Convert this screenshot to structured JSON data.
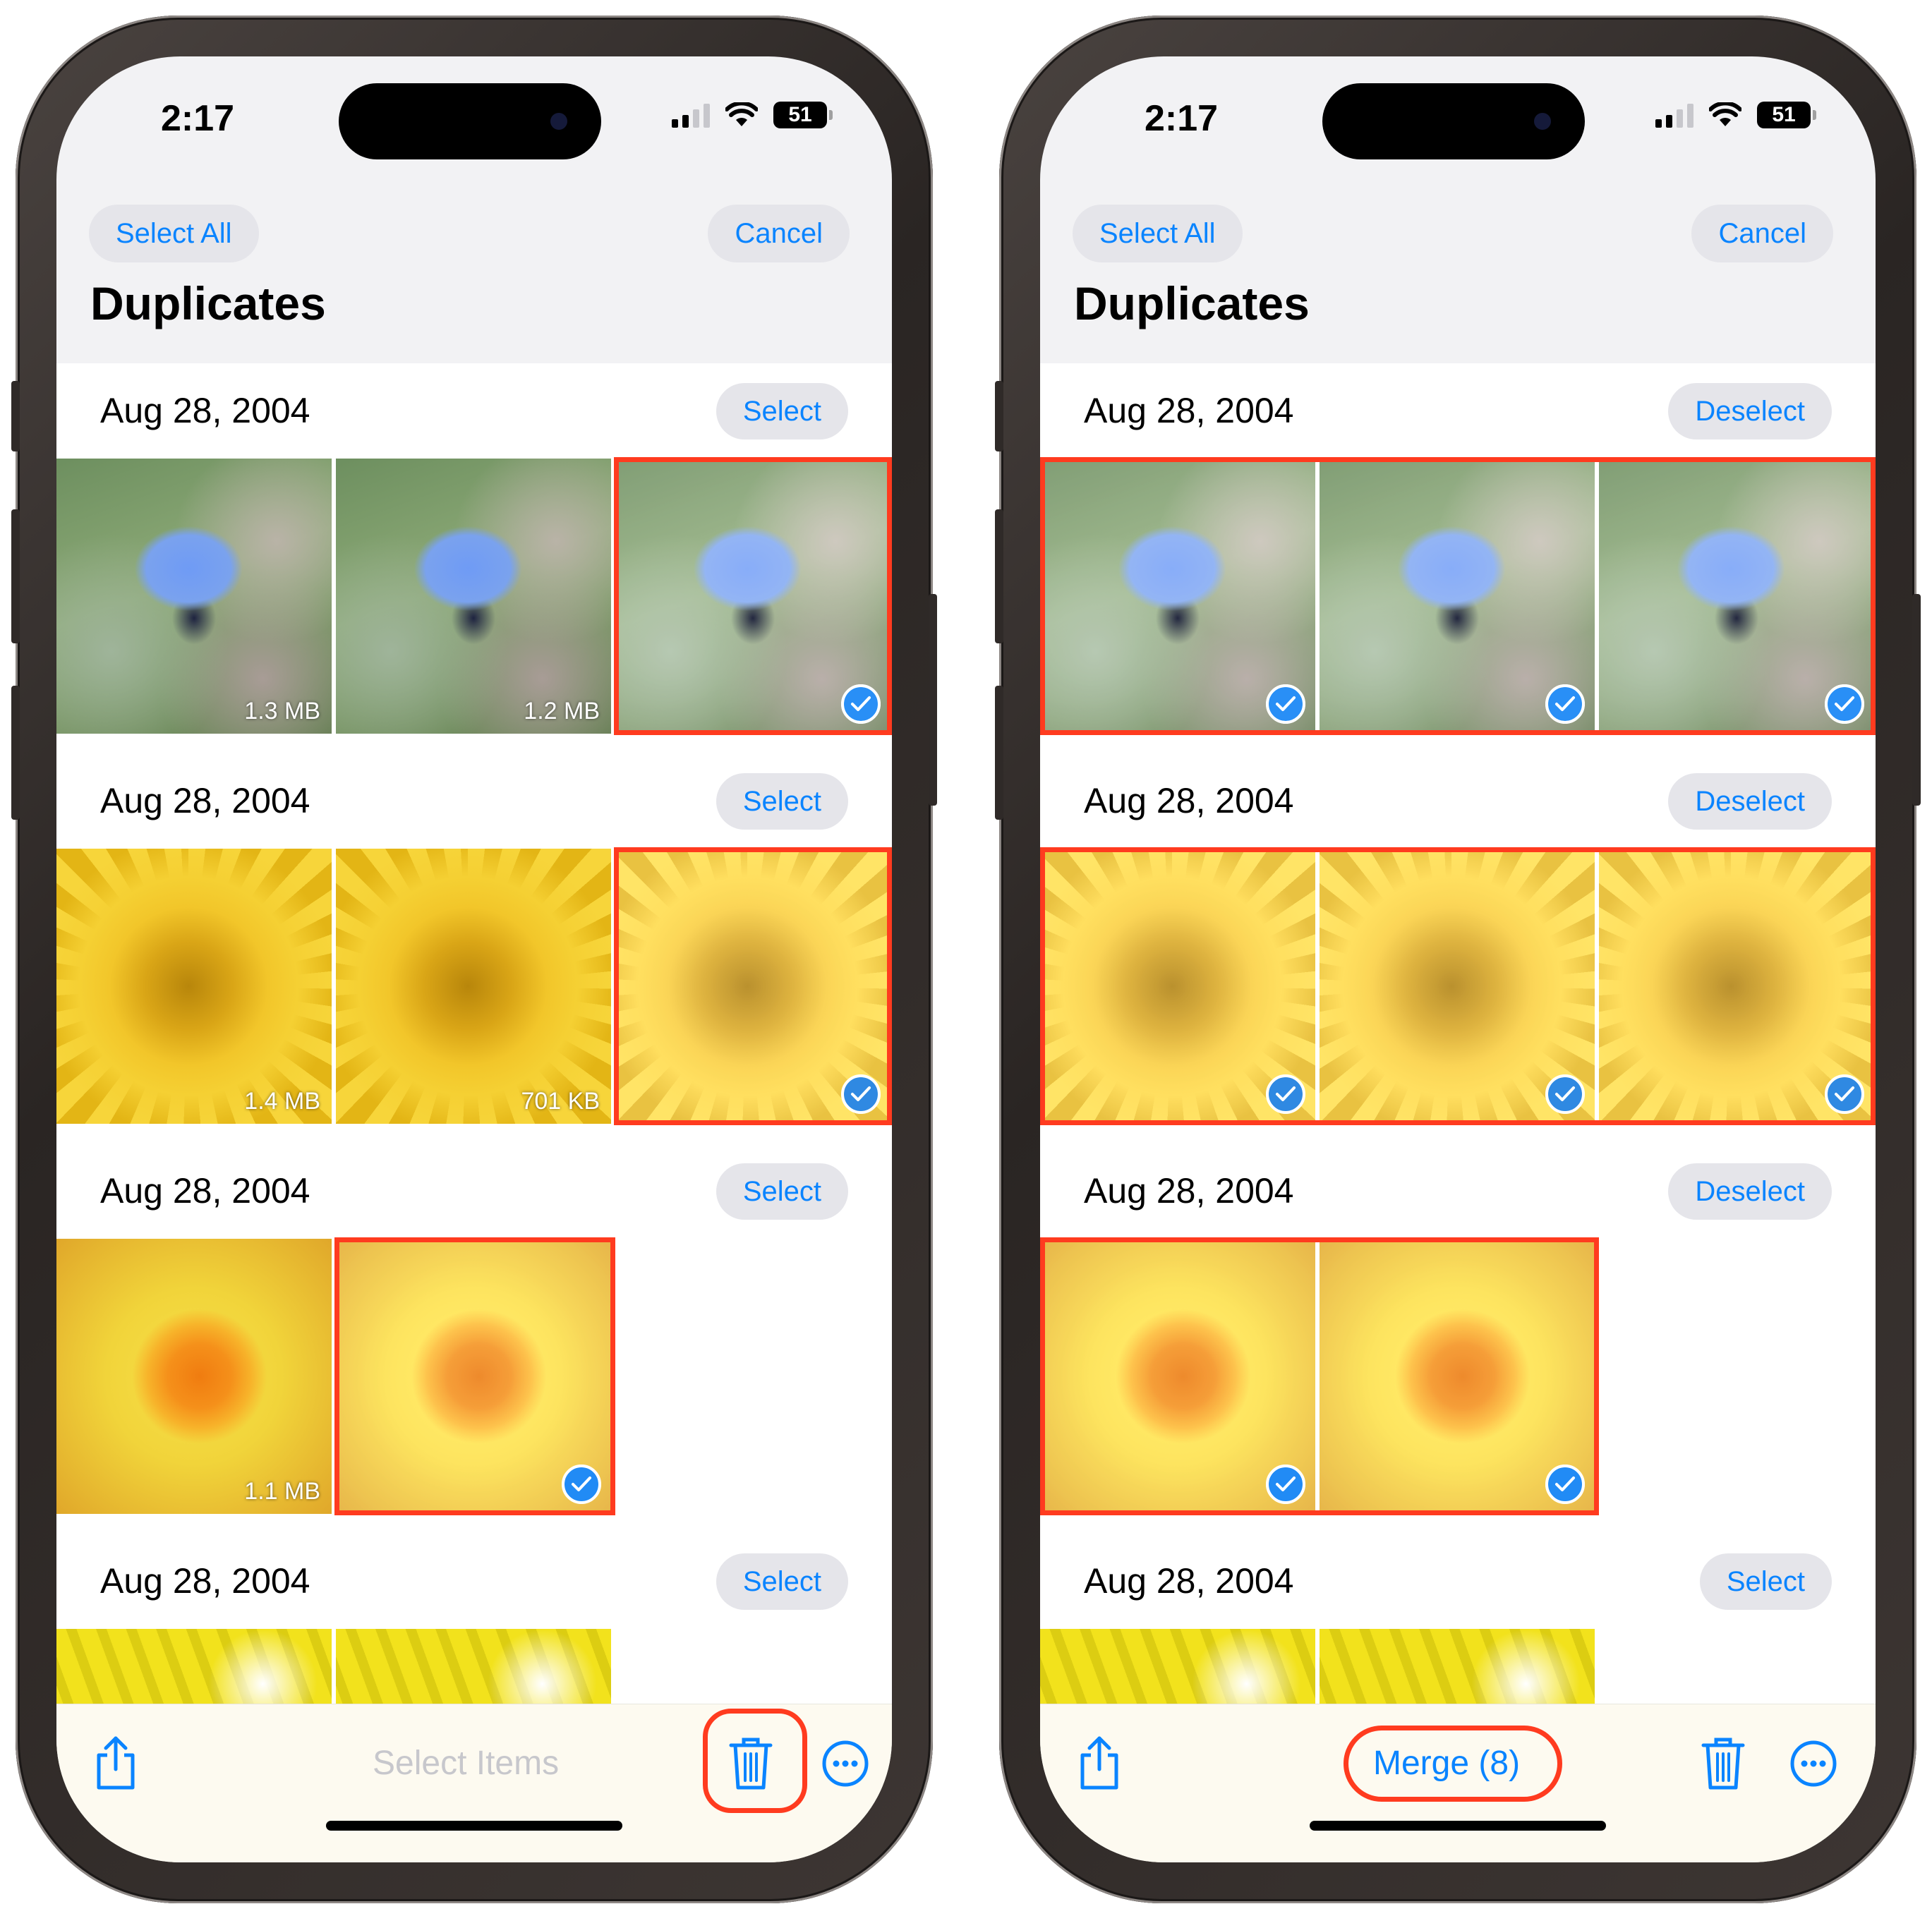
{
  "left_phone": {
    "status": {
      "time": "2:17",
      "battery": "51"
    },
    "nav": {
      "select_all": "Select All",
      "cancel": "Cancel",
      "title": "Duplicates"
    },
    "sections": [
      {
        "date": "Aug 28, 2004",
        "action": "Select",
        "photos": [
          {
            "size": "1.3 MB",
            "selected": false
          },
          {
            "size": "1.2 MB",
            "selected": false
          },
          {
            "size": "",
            "selected": true
          }
        ]
      },
      {
        "date": "Aug 28, 2004",
        "action": "Select",
        "photos": [
          {
            "size": "1.4 MB",
            "selected": false
          },
          {
            "size": "701 KB",
            "selected": false
          },
          {
            "size": "",
            "selected": true
          }
        ]
      },
      {
        "date": "Aug 28, 2004",
        "action": "Select",
        "photos": [
          {
            "size": "1.1 MB",
            "selected": false
          },
          {
            "size": "",
            "selected": true
          }
        ]
      },
      {
        "date": "Aug 28, 2004",
        "action": "Select"
      }
    ],
    "toolbar": {
      "center_label": "Select Items",
      "center_color": "#c7c7cc"
    }
  },
  "right_phone": {
    "status": {
      "time": "2:17",
      "battery": "51"
    },
    "nav": {
      "select_all": "Select All",
      "cancel": "Cancel",
      "title": "Duplicates"
    },
    "sections": [
      {
        "date": "Aug 28, 2004",
        "action": "Deselect"
      },
      {
        "date": "Aug 28, 2004",
        "action": "Deselect"
      },
      {
        "date": "Aug 28, 2004",
        "action": "Deselect"
      },
      {
        "date": "Aug 28, 2004",
        "action": "Select"
      }
    ],
    "toolbar": {
      "center_label": "Merge (8)",
      "center_color": "#0a84ff"
    }
  },
  "colors": {
    "accent": "#0a84ff",
    "highlight": "#ff3b1f"
  },
  "icons": [
    "share-icon",
    "trash-icon",
    "more-icon",
    "checkmark-icon",
    "wifi-icon",
    "signal-icon",
    "battery-icon"
  ]
}
